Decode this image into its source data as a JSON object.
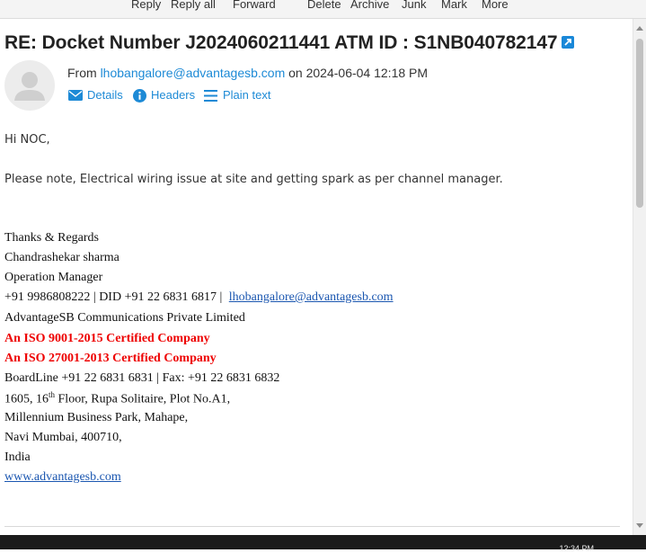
{
  "toolbar": {
    "reply": "Reply",
    "reply_all": "Reply all",
    "forward": "Forward",
    "delete": "Delete",
    "archive": "Archive",
    "junk": "Junk",
    "mark": "Mark",
    "more": "More"
  },
  "message": {
    "subject": "RE: Docket Number J2024060211441 ATM ID : S1NB040782147",
    "from_prefix": "From",
    "from_email": "lhobangalore@advantagesb.com",
    "date_prefix": "on",
    "date": "2024-06-04 12:18 PM",
    "links": {
      "details": "Details",
      "headers": "Headers",
      "plain_text": "Plain text"
    }
  },
  "body": {
    "greeting": "Hi NOC,",
    "paragraph": "Please note, Electrical wiring issue at site and getting spark as per channel manager.",
    "signature": {
      "regards": "Thanks & Regards",
      "name": "Chandrashekar sharma",
      "title": "Operation Manager",
      "phone": "+91 9986808222 | DID +91 22 6831 6817 |",
      "email": "lhobangalore@advantagesb.com",
      "company": "AdvantageSB Communications Private Limited",
      "iso1": "An ISO 9001-2015 Certified Company",
      "iso2": "An ISO 27001-2013 Certified Company",
      "boardline": "BoardLine +91 22 6831 6831 | Fax: +91 22 6831 6832",
      "addr1_pre": "1605, 16",
      "addr1_sup": "th",
      "addr1_post": " Floor, Rupa Solitaire, Plot No.A1,",
      "addr2": "Millennium Business Park, Mahape,",
      "addr3": "Navi Mumbai, 400710,",
      "addr4": "India",
      "website": "www.advantagesb.com"
    }
  },
  "taskbar": {
    "time": "12:34 PM"
  },
  "colors": {
    "link": "#1d8ad6",
    "iso_red": "#ee0000",
    "accent": "#1a88d8"
  }
}
